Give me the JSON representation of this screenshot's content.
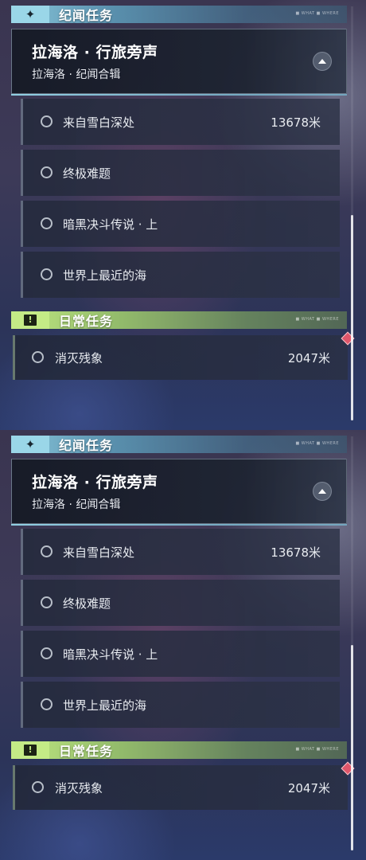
{
  "panels": [
    {
      "story_section": {
        "icon": "sparkle-star-icon",
        "title": "纪闻任务",
        "tag": "■ WHAT ■ WHERE"
      },
      "quest": {
        "title": "拉海洛 · 行旅旁声",
        "subtitle": "拉海洛 · 纪闻合辑",
        "collapse_icon": "chevron-up-icon"
      },
      "sub_quests": [
        {
          "label": "来自雪白深处",
          "distance": "13678米"
        },
        {
          "label": "终极难题",
          "distance": ""
        },
        {
          "label": "暗黑决斗传说 · 上",
          "distance": ""
        },
        {
          "label": "世界上最近的海",
          "distance": ""
        }
      ],
      "daily_section": {
        "icon": "exclamation-icon",
        "icon_glyph": "!",
        "title": "日常任务",
        "tag": "■ WHAT ■ WHERE"
      },
      "daily_quest": {
        "label": "消灭残象",
        "distance": "2047米"
      }
    },
    {
      "story_section": {
        "icon": "sparkle-star-icon",
        "title": "纪闻任务",
        "tag": "■ WHAT ■ WHERE"
      },
      "quest": {
        "title": "拉海洛 · 行旅旁声",
        "subtitle": "拉海洛 · 纪闻合辑",
        "collapse_icon": "chevron-up-icon"
      },
      "sub_quests": [
        {
          "label": "来自雪白深处",
          "distance": "13678米"
        },
        {
          "label": "终极难题",
          "distance": ""
        },
        {
          "label": "暗黑决斗传说 · 上",
          "distance": ""
        },
        {
          "label": "世界上最近的海",
          "distance": ""
        }
      ],
      "daily_section": {
        "icon": "exclamation-icon",
        "icon_glyph": "!",
        "title": "日常任务",
        "tag": "■ WHAT ■ WHERE"
      },
      "daily_quest": {
        "label": "消灭残象",
        "distance": "2047米"
      }
    }
  ],
  "colors": {
    "story_accent": "#9ad6e8",
    "daily_accent": "#c4eb86",
    "marker": "#e0566a"
  }
}
